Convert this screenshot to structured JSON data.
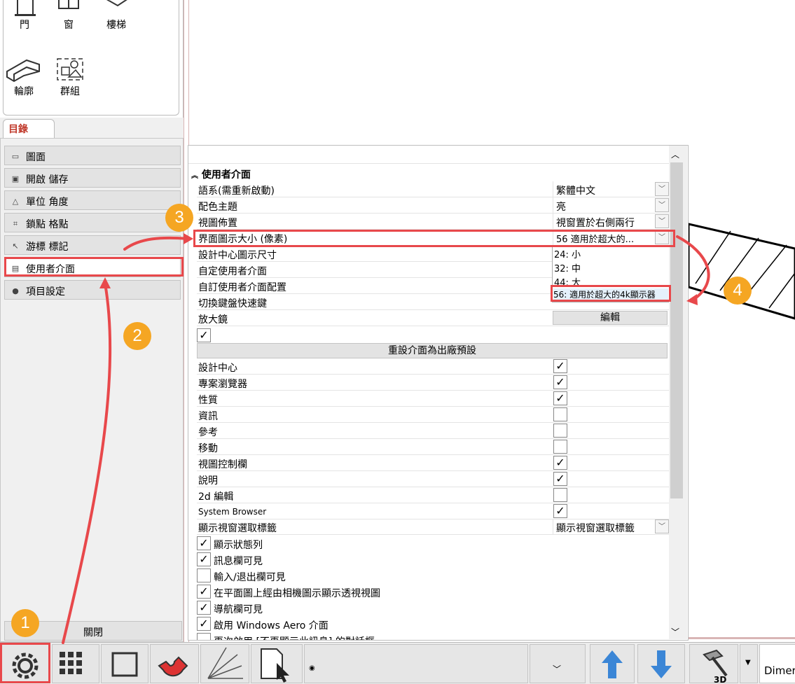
{
  "tools": {
    "door": "門",
    "window": "窗",
    "stair": "樓梯",
    "profile": "輪廓",
    "group": "群組"
  },
  "catalog_tab": "目錄",
  "categories": [
    {
      "label": "圖面",
      "icon": "monitor-icon"
    },
    {
      "label": "開啟 儲存",
      "icon": "save-icon"
    },
    {
      "label": "單位 角度",
      "icon": "angle-icon"
    },
    {
      "label": "鎖點 格點",
      "icon": "snap-icon"
    },
    {
      "label": "游標 標記",
      "icon": "cursor-icon"
    },
    {
      "label": "使用者介面",
      "icon": "window-icon"
    },
    {
      "label": "項目設定",
      "icon": "globe-icon"
    }
  ],
  "close_label": "關閉",
  "settings": {
    "section_title": "使用者介面",
    "rows": [
      {
        "label": "語系(需重新啟動)",
        "value": "繁體中文"
      },
      {
        "label": "配色主題",
        "value": "亮"
      },
      {
        "label": "視圖佈置",
        "value": "視窗置於右側兩行"
      },
      {
        "label": "界面圖示大小 (像素)",
        "value": "56 適用於超大的..."
      },
      {
        "label": "設計中心圖示尺寸",
        "value": ""
      },
      {
        "label": "自定使用者介面",
        "value": ""
      },
      {
        "label": "自訂使用者介面配置",
        "value": ""
      },
      {
        "label": "切換鍵盤快速鍵",
        "value": ""
      },
      {
        "label": "放大鏡",
        "value": "編輯"
      }
    ],
    "dropdown_options": [
      "24: 小",
      "32: 中",
      "44: 大",
      "56: 適用於超大的4k顯示器"
    ],
    "reset_label": "重設介面為出廠預設",
    "panels": [
      {
        "label": "設計中心",
        "checked": true
      },
      {
        "label": "專案瀏覽器",
        "checked": true
      },
      {
        "label": "性質",
        "checked": true
      },
      {
        "label": "資訊",
        "checked": false
      },
      {
        "label": "參考",
        "checked": false
      },
      {
        "label": "移動",
        "checked": false
      },
      {
        "label": "視圖控制欄",
        "checked": true
      },
      {
        "label": "說明",
        "checked": true
      },
      {
        "label": "2d 編輯",
        "checked": false
      },
      {
        "label": "System Browser",
        "checked": true
      }
    ],
    "view_tab_row": {
      "label": "顯示視窗選取標籤",
      "value": "顯示視窗選取標籤"
    },
    "options": [
      {
        "label": "顯示狀態列",
        "checked": true
      },
      {
        "label": "訊息欄可見",
        "checked": true
      },
      {
        "label": "輸入/退出欄可見",
        "checked": false
      },
      {
        "label": "在平面圖上經由相機圖示顯示透視視圖",
        "checked": true
      },
      {
        "label": "導航欄可見",
        "checked": true
      },
      {
        "label": "啟用 Windows Aero 介面",
        "checked": true
      },
      {
        "label": "再次啟用 [不再顯示此訊息] 的對話框",
        "checked": false
      }
    ]
  },
  "callouts": [
    "1",
    "2",
    "3",
    "4"
  ],
  "toolbar": {
    "dimension_text": "Dimer"
  },
  "accent_color": "#e8484b",
  "callout_color": "#f5a623"
}
